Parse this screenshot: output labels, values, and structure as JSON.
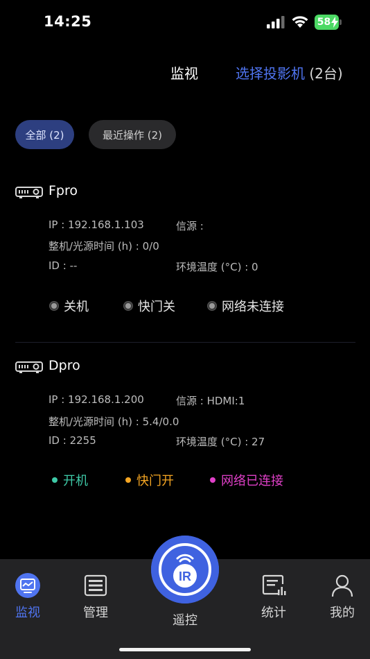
{
  "status_bar": {
    "time": "14:25",
    "battery": "58",
    "icons": [
      "signal-icon",
      "wifi-icon",
      "battery-icon"
    ]
  },
  "header": {
    "title": "监视",
    "select_label": "选择投影机",
    "select_count": "(2台)"
  },
  "filters": [
    {
      "label": "全部 (2)",
      "active": true
    },
    {
      "label": "最近操作 (2)",
      "active": false
    }
  ],
  "devices": [
    {
      "name": "Fpro",
      "ip": "IP : 192.168.1.103",
      "source": "信源 :",
      "hours": "整机/光源时间 (h) : 0/0",
      "id": "ID : --",
      "temp": "环境温度 (°C) : 0",
      "power": "关机",
      "shutter": "快门关",
      "network": "网络未连接"
    },
    {
      "name": "Dpro",
      "ip": "IP : 192.168.1.200",
      "source": "信源 : HDMI:1",
      "hours": "整机/光源时间 (h) : 5.4/0.0",
      "id": "ID : 2255",
      "temp": "环境温度 (°C) : 27",
      "power": "开机",
      "shutter": "快门开",
      "network": "网络已连接"
    }
  ],
  "colors": {
    "accent": "#4f74f0",
    "power_on": "#3ec9a7",
    "shutter_open": "#f5a623",
    "network_on": "#e040c8",
    "offline": "#9a9a9a"
  },
  "nav": {
    "monitor": "监视",
    "manage": "管理",
    "remote": "遥控",
    "remote_badge": "IR",
    "stats": "统计",
    "mine": "我的"
  }
}
